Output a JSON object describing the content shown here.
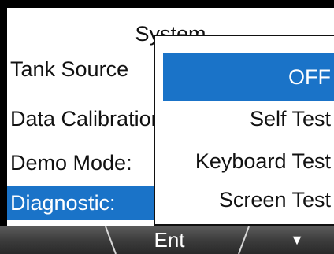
{
  "screen": {
    "title": "System"
  },
  "menu": {
    "items": [
      {
        "label": "Tank Source",
        "selected": false
      },
      {
        "label": "Data Calibration",
        "selected": false
      },
      {
        "label": "Demo Mode:",
        "selected": false
      },
      {
        "label": "Diagnostic:",
        "selected": true
      }
    ]
  },
  "popup": {
    "options": [
      {
        "label": "OFF",
        "selected": true
      },
      {
        "label": "Self Test",
        "selected": false
      },
      {
        "label": "Keyboard Test",
        "selected": false
      },
      {
        "label": "Screen Test",
        "selected": false
      }
    ]
  },
  "softkeys": {
    "left_label": "",
    "center_label": "Ent",
    "right_icon": "down-triangle-icon",
    "right_glyph": "▼"
  },
  "colors": {
    "selection": "#1a73c8",
    "background": "#ffffff",
    "bezel": "#000000",
    "softkey_bar": "#3a3a3a"
  }
}
